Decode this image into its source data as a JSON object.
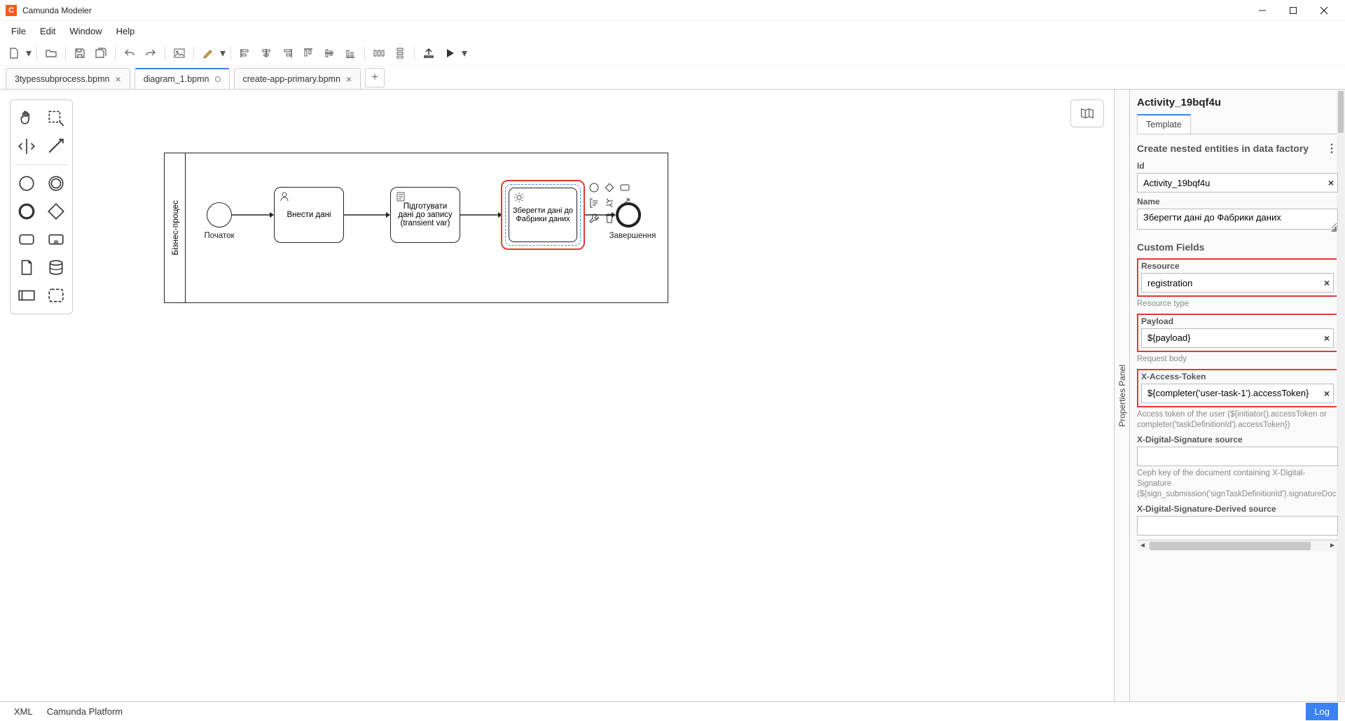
{
  "app": {
    "title": "Camunda Modeler"
  },
  "menu": [
    "File",
    "Edit",
    "Window",
    "Help"
  ],
  "tabs": [
    {
      "label": "3typessubprocess.bpmn",
      "active": false,
      "dirty": false
    },
    {
      "label": "diagram_1.bpmn",
      "active": true,
      "dirty": true
    },
    {
      "label": "create-app-primary.bpmn",
      "active": false,
      "dirty": false
    }
  ],
  "diagram": {
    "pool_label": "Бізнес-процес",
    "start_label": "Початок",
    "task1": "Внести дані",
    "task2": "Підготувати дані до запису (transient var)",
    "task3": "Зберегти дані до Фабрики даних",
    "end_label": "Завершення"
  },
  "panel": {
    "toggle": "Properties Panel",
    "title": "Activity_19bqf4u",
    "tab": "Template",
    "section_template": "Create nested entities in data factory",
    "id_label": "Id",
    "id_value": "Activity_19bqf4u",
    "name_label": "Name",
    "name_value": "Зберегти дані до Фабрики даних",
    "custom_fields": "Custom Fields",
    "resource_label": "Resource",
    "resource_value": "registration",
    "resource_hint": "Resource type",
    "payload_label": "Payload",
    "payload_value": "${payload}",
    "payload_hint": "Request body",
    "token_label": "X-Access-Token",
    "token_value": "${completer('user-task-1').accessToken}",
    "token_hint": "Access token of the user (${initiator().accessToken or completer('taskDefinitionId').accessToken})",
    "xds_label": "X-Digital-Signature source",
    "xds_hint": "Ceph key of the document containing X-Digital-Signature (${sign_submission('signTaskDefinitionId').signatureDocum",
    "xdsd_label": "X-Digital-Signature-Derived source"
  },
  "status": {
    "xml": "XML",
    "platform": "Camunda Platform",
    "log": "Log"
  }
}
